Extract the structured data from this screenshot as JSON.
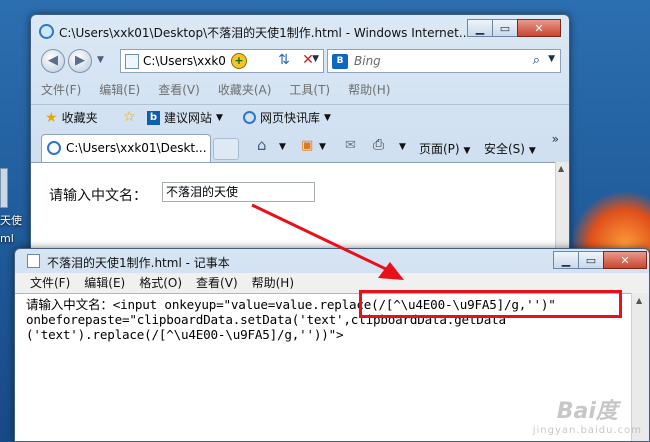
{
  "desktop": {
    "label_1": "天使",
    "label_2": "ml"
  },
  "ie": {
    "title": "C:\\Users\\xxk01\\Desktop\\不落泪的天使1制作.html - Windows Internet...",
    "address": "C:\\Users\\xxk0",
    "search_placeholder": "Bing",
    "search_logo": "B",
    "menu": [
      "文件(F)",
      "编辑(E)",
      "查看(V)",
      "收藏夹(A)",
      "工具(T)",
      "帮助(H)"
    ],
    "favorites": {
      "favorites_label": "收藏夹",
      "suggested_sites": "建议网站",
      "web_slice_gallery": "网页快讯库"
    },
    "tab_title": "C:\\Users\\xxk01\\Deskt...",
    "commands": {
      "page": "页面(P)",
      "safety": "安全(S)"
    },
    "page": {
      "label": "请输入中文名：",
      "input_value": "不落泪的天使"
    }
  },
  "notepad": {
    "title": "不落泪的天使1制作.html - 记事本",
    "menu": [
      "文件(F)",
      "编辑(E)",
      "格式(O)",
      "查看(V)",
      "帮助(H)"
    ],
    "lines": [
      "请输入中文名：<input onkeyup=\"value=value.replace(/[^\\u4E00-\\u9FA5]/g,'')\"",
      "onbeforepaste=\"clipboardData.setData('text',clipboardData.getData",
      "('text').replace(/[^\\u4E00-\\u9FA5]/g,''))\">"
    ]
  },
  "watermark": {
    "logo": "Bai度",
    "sub": "jingyan.baidu.com"
  },
  "colors": {
    "annotation_red": "#e8101a",
    "desktop_blue": "#1f5a99"
  }
}
